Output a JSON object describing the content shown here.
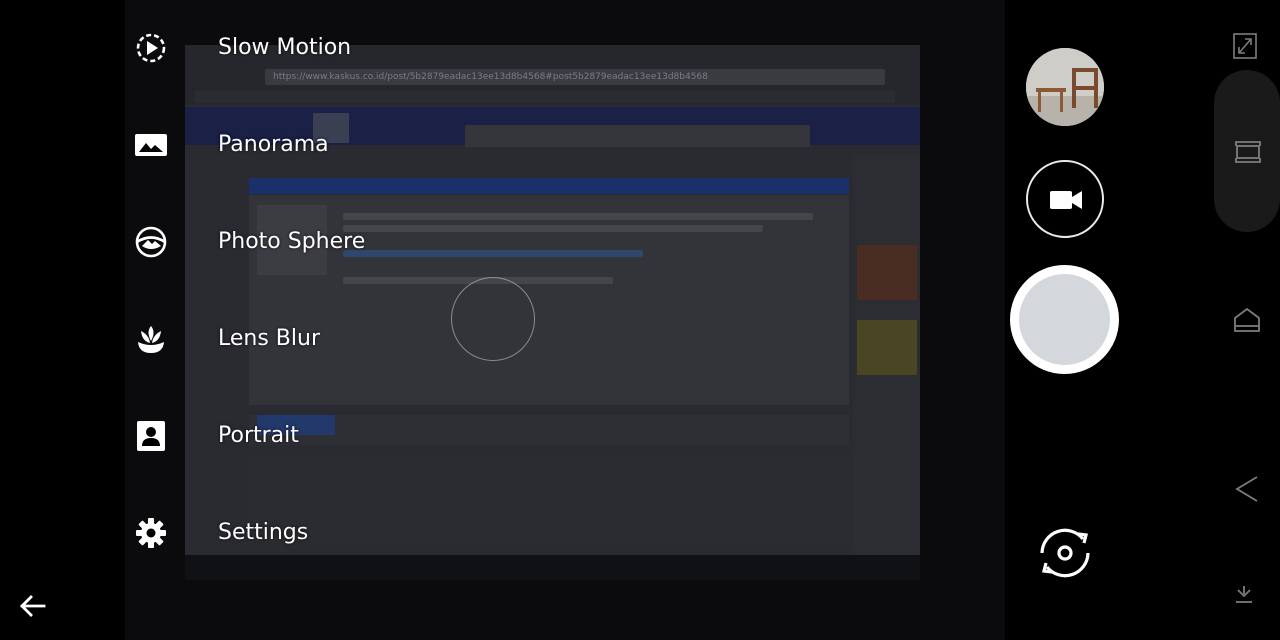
{
  "modes": [
    {
      "label": "Slow Motion",
      "icon": "slow-motion-icon"
    },
    {
      "label": "Panorama",
      "icon": "panorama-icon"
    },
    {
      "label": "Photo Sphere",
      "icon": "photo-sphere-icon"
    },
    {
      "label": "Lens Blur",
      "icon": "lens-blur-icon"
    },
    {
      "label": "Portrait",
      "icon": "portrait-icon"
    },
    {
      "label": "Settings",
      "icon": "gear-icon"
    }
  ],
  "viewfinder": {
    "url_text": "https://www.kaskus.co.id/post/5b2879eadac13ee13d8b4568#post5b2879eadac13ee13d8b4568"
  },
  "controls": {
    "back": "back-arrow-icon",
    "gallery": "gallery-thumbnail",
    "video": "video-camera-icon",
    "shutter": "shutter-button",
    "switch": "switch-camera-icon"
  },
  "system_nav": {
    "icons": [
      "screen-rotate-icon",
      "recents-icon",
      "home-icon",
      "back-triangle-icon",
      "hide-nav-icon"
    ]
  },
  "colors": {
    "background": "#000000",
    "shutter_outer": "#ffffff",
    "shutter_inner": "#d4d8dd",
    "video_ring": "#e9ebed"
  }
}
